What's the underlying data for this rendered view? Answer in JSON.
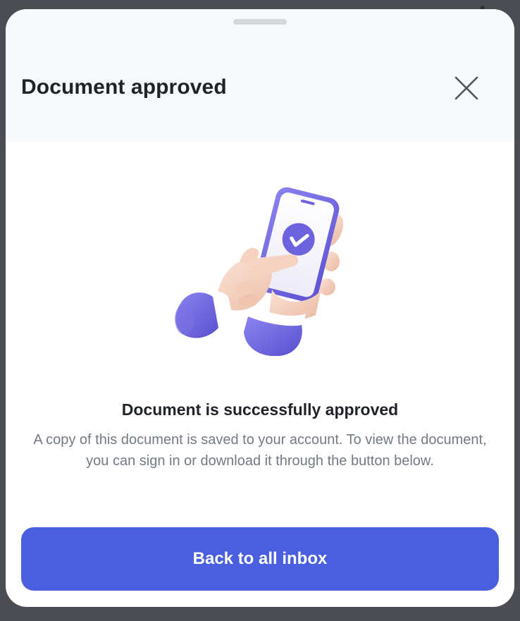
{
  "sheet": {
    "title": "Document approved",
    "close_icon": "close-icon",
    "illustration_icon": "hand-holding-phone-check-icon"
  },
  "message": {
    "title": "Document is successfully approved",
    "body": "A copy of this document is saved to your account. To view the document, you can sign in or download it through the button below."
  },
  "actions": {
    "primary_label": "Back to all inbox"
  },
  "colors": {
    "accent": "#4a5fe0",
    "illustration_purple": "#6e63df",
    "header_bg": "#f7f8fa",
    "title_text": "#1f2227",
    "body_text": "#747a83",
    "backdrop": "#4b4d52"
  }
}
